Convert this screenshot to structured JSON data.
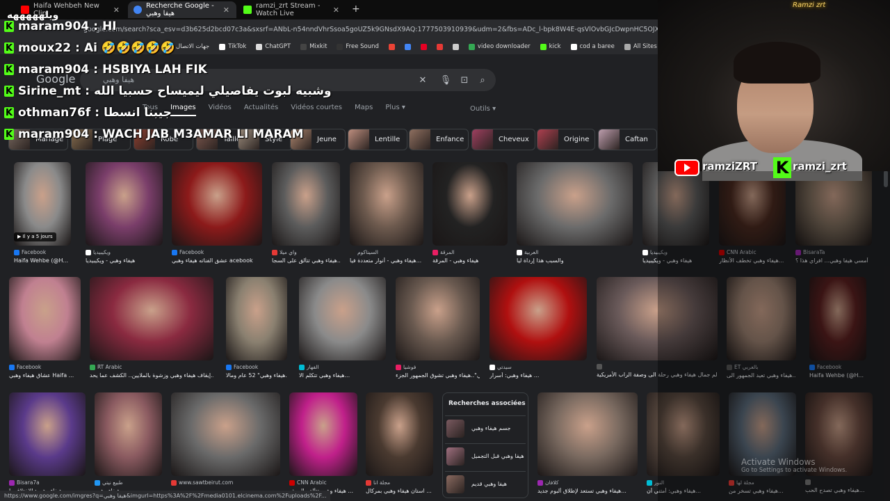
{
  "tabs": [
    {
      "label": "Haifa Wehbeh New Clip",
      "color": "#ff0000"
    },
    {
      "label": "Recherche Google - هيفا وهبي",
      "color": "#4285f4"
    },
    {
      "label": "ramzi_zrt Stream - Watch Live",
      "color": "#53fc18"
    }
  ],
  "new_tab": "+",
  "url": "google.com/search?sca_esv=d3b625d2bcd07c3a&sxsrf=ANbL-n54nndVhrSsoa5goUZ5k9GNsdX9AQ:1777503910939&udm=2&fbs=ADc_l-bpk8W4E-qsVlOvbGJcDwpnHC5OJXXTJvmMu2n9YYx-G8xz",
  "bookmarks": [
    {
      "label": "جهات الاتصال",
      "color": "#8ab4f8"
    },
    {
      "label": "TikTok",
      "color": "#ffffff"
    },
    {
      "label": "ChatGPT",
      "color": "#dddddd"
    },
    {
      "label": "Mixkit",
      "color": "#444444"
    },
    {
      "label": "Free Sound",
      "color": "#333333"
    },
    {
      "label": "",
      "color": "#ea4335"
    },
    {
      "label": "",
      "color": "#4285f4"
    },
    {
      "label": "",
      "color": "#e60023"
    },
    {
      "label": "",
      "color": "#e53935"
    },
    {
      "label": "",
      "color": "#cccccc"
    },
    {
      "label": "video downloader",
      "color": "#34a853"
    },
    {
      "label": "kick",
      "color": "#53fc18"
    },
    {
      "label": "cod a baree",
      "color": "#ffffff"
    },
    {
      "label": "All Sites",
      "color": "#aaaaaa"
    }
  ],
  "google": {
    "logo": "Google",
    "query": "هيفا وهبي",
    "nav": [
      "Tous",
      "Images",
      "Vidéos",
      "Actualités",
      "Vidéos courtes",
      "Maps",
      "Plus ▾"
    ],
    "tools": "Outils ▾",
    "chips": [
      {
        "label": "Mariage",
        "color": "#7a6a60"
      },
      {
        "label": "Plage",
        "color": "#8a7050"
      },
      {
        "label": "Robe",
        "color": "#904030"
      },
      {
        "label": "Taille",
        "color": "#805a50"
      },
      {
        "label": "Style",
        "color": "#a09080"
      },
      {
        "label": "Jeune",
        "color": "#b08870"
      },
      {
        "label": "Lentille",
        "color": "#c09080"
      },
      {
        "label": "Enfance",
        "color": "#907060"
      },
      {
        "label": "Cheveux",
        "color": "#a04060"
      },
      {
        "label": "Origine",
        "color": "#b04050"
      },
      {
        "label": "Caftan",
        "color": "#c0a0b0"
      }
    ],
    "badge": "▶ Il y a 5 jours",
    "row1": [
      {
        "source": "Facebook",
        "title": "Haifa Wehbe (@H...",
        "color": "#8a8a8a",
        "icon": "#1877f2"
      },
      {
        "source": "ويكيبيديا",
        "title": "هيفاء وهبي - ويكيبيديا",
        "color": "#7a3e6a",
        "icon": "#ffffff"
      },
      {
        "source": "Facebook",
        "title": "عشق الفناته هيفاء وهبي acebook",
        "color": "#8c1a1a",
        "icon": "#1877f2"
      },
      {
        "source": "واي ميلا",
        "title": "هيفاء وهبي تتألق على السجا...",
        "color": "#5c5c5c",
        "icon": "#e53935"
      },
      {
        "source": "السيناكوم",
        "title": "هيفاء وهبي - أنوار متعددة فيا...",
        "color": "#6d5a4e",
        "icon": "#222222"
      },
      {
        "source": "المرقة",
        "title": "هيفاء وهبي - المرقة",
        "color": "#222222",
        "icon": "#e91e63"
      },
      {
        "source": "العربية",
        "title": "والسبب هذا إرداة ليا",
        "color": "#6b6b6b",
        "icon": "#ffffff"
      },
      {
        "source": "ويكيبيديا",
        "title": "هيفاء وهبي - ويكيبيديا",
        "color": "#5a5a5a",
        "icon": "#ffffff"
      },
      {
        "source": "CNN Arabic",
        "title": "هيفاء وهبي تخطف الأنظار...",
        "color": "#4a2a20",
        "icon": "#cc0000"
      },
      {
        "source": "BisaraTa",
        "title": "أمسي هيفا وهبي... افراي هذا ؟",
        "color": "#7a6a5a",
        "icon": "#9c27b0"
      }
    ],
    "row2": [
      {
        "source": "Facebook",
        "title": "عشاق هيفاء وهبي Haifa ...",
        "color": "#c08090",
        "icon": "#1877f2"
      },
      {
        "source": "RT Arabic",
        "title": "إيقاف هيفاء وهبي وزشوة بالملايين.. الكشف عما يحد...",
        "color": "#8a2a40",
        "icon": "#34a853"
      },
      {
        "source": "Facebook",
        "title": "هيفاء وهبي\" 52 عام ومالا...",
        "color": "#8a8070",
        "icon": "#1877f2"
      },
      {
        "source": "الفهار",
        "title": "هيفاء وهبي تتكلم الا...",
        "color": "#8a8a8a",
        "icon": "#00bcd4"
      },
      {
        "source": "فوشيا",
        "title": "بيتي الثاني\"..هيفاء وهبي تشوق الجمهور الجزء ...",
        "color": "#6a5a50",
        "icon": "#e91e63"
      },
      {
        "source": "سيدتي",
        "title": "هيفاء وهبي: أسرار ...",
        "color": "#b01010",
        "icon": "#ffffff"
      },
      {
        "source": "",
        "title": "عالم جمال هيفاء وهبي رحلة الى وصفة الراب الأمريكية...",
        "color": "#6a5a5a",
        "icon": "#555555"
      },
      {
        "source": "ET بالعربي",
        "title": "هيفاء وهبي تعيد الجمهور الى...",
        "color": "#9a8070",
        "icon": "#555555"
      },
      {
        "source": "Facebook",
        "title": "Haifa Wehbe (@H...",
        "color": "#5a2020",
        "icon": "#1877f2"
      }
    ],
    "row3": [
      {
        "source": "Bisara7a",
        "title": "هيفاء وهبي: الاختلاف يا...",
        "color": "#5a3a8a",
        "icon": "#9c27b0"
      },
      {
        "source": "طبيع نيتي",
        "title": "هيفاء وهبي...",
        "color": "#8a5a60",
        "icon": "#2196f3"
      },
      {
        "source": "www.sawtbeirut.com",
        "title": "",
        "color": "#6a6a6a",
        "icon": "#e53935"
      },
      {
        "source": "CNN Arabic",
        "title": "هيفاء وهبي تتألق بالريش ...",
        "color": "#c0208a",
        "icon": "#cc0000"
      },
      {
        "source": "مجلة انا",
        "title": "استان هيفاء وهبي بمركال ...",
        "color": "#4a3a30",
        "icon": "#e53935"
      },
      {
        "source": "كلافان",
        "title": "هيفاء وهبي تستعد لإطلاق ألبوم جديد...",
        "color": "#7a6a60",
        "icon": "#9c27b0"
      },
      {
        "source": "النور",
        "title": "هيفاء وهبي: أمتني أن...",
        "color": "#5a4a40",
        "icon": "#00bcd4"
      },
      {
        "source": "مجلة لها",
        "title": "هيفاء وهبي تسخر من...",
        "color": "#5a6a7a",
        "icon": "#e53935"
      },
      {
        "source": "",
        "title": "هيفاء وهبي تصدح الحب...",
        "color": "#6a4a40",
        "icon": "#777777"
      }
    ],
    "related_title": "Recherches associées",
    "related": [
      {
        "label": "جسم هيفاء وهبي",
        "color": "#7a5a60"
      },
      {
        "label": "هيفا وهبي قبل التجميل",
        "color": "#a07080"
      },
      {
        "label": "هيفا وهبي قديم",
        "color": "#8a6a60"
      }
    ]
  },
  "chat": {
    "header": "ويلهههههه",
    "messages": [
      {
        "user": "maram904",
        "text": "HI"
      },
      {
        "user": "moux22",
        "text": "Ai 🤣🤣🤣🤣🤣"
      },
      {
        "user": "maram904",
        "text": "HSBIYA LAH FIK"
      },
      {
        "user": "Sirine_mt",
        "text": "وشبيه لبوت يفاصيلي ليميساح حسبيا الله"
      },
      {
        "user": "othman76f",
        "text": "جيبنا انسطا"
      },
      {
        "user": "maram904",
        "text": "WACH JAB M3AMAR LI MARAM"
      }
    ]
  },
  "overlay": {
    "neon": "Ramzi zrt",
    "youtube_name": "ramziZRT",
    "kick_letter": "K",
    "kick_name": "ramzi_zrt"
  },
  "status_url": "https://www.google.com/imgres?q=هيفا وهبي&imgurl=https%3A%2F%2Fmedia0101.elcinema.com%2Fuploads%2F...",
  "windows": {
    "line1": "Activate Windows",
    "line2": "Go to Settings to activate Windows."
  }
}
